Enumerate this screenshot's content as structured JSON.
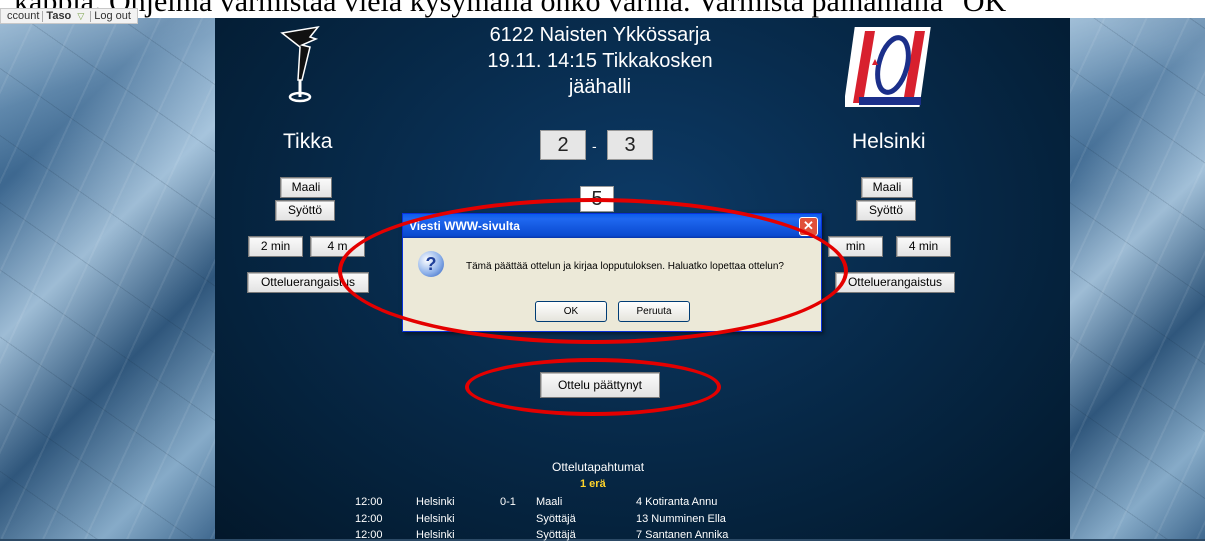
{
  "caption": "kappia. Ohjelma varmistaa vielä kysymällä onko varma. Varmista painamalla \"OK\"",
  "toolbar": {
    "account": "ccount",
    "taso": "Taso",
    "logout": "Log out"
  },
  "match": {
    "title_line1": "6122 Naisten Ykkössarja",
    "title_line2": "19.11. 14:15 Tikkakosken",
    "title_line3": "jäähalli",
    "home_team": "Tikka",
    "away_team": "Helsinki",
    "home_score": "2",
    "away_score": "3",
    "score_dash": "-",
    "period": "5"
  },
  "home_buttons": {
    "goal": "Maali",
    "assist": "Syöttö",
    "two_min": "2 min",
    "four_min": "4 m",
    "match_penalty": "Otteluerangaistus"
  },
  "away_buttons": {
    "goal": "Maali",
    "assist": "Syöttö",
    "two_min": "min",
    "four_min": "4 min",
    "match_penalty": "Otteluerangaistus"
  },
  "dialog": {
    "title": "Viesti WWW-sivulta",
    "message": "Tämä päättää ottelun ja kirjaa lopputuloksen. Haluatko lopettaa ottelun?",
    "ok": "OK",
    "cancel": "Peruuta"
  },
  "end_button": "Ottelu päättynyt",
  "events": {
    "heading": "Ottelutapahtumat",
    "period_label": "1 erä",
    "rows": [
      {
        "time": "12:00",
        "team": "Helsinki",
        "score": "0-1",
        "type": "Maali",
        "player": "4 Kotiranta Annu"
      },
      {
        "time": "12:00",
        "team": "Helsinki",
        "score": "",
        "type": "Syöttäjä",
        "player": "13 Numminen Ella"
      },
      {
        "time": "12:00",
        "team": "Helsinki",
        "score": "",
        "type": "Syöttäjä",
        "player": "7 Santanen Annika"
      }
    ]
  },
  "colors": {
    "accent_red": "#e40000",
    "period_label": "#ffd42a",
    "dialog_titlebar": "#0a5cec"
  }
}
